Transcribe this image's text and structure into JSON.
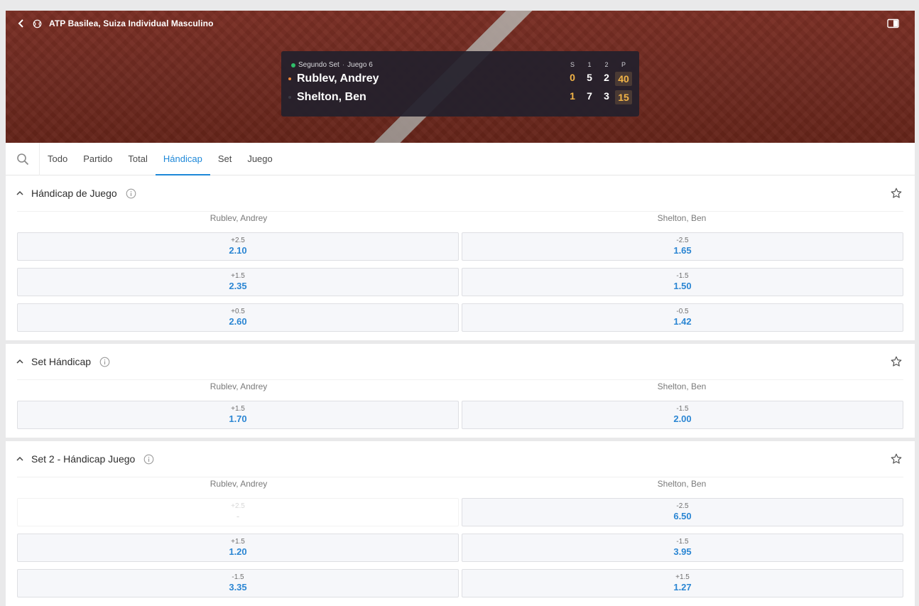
{
  "header": {
    "title": "ATP Basilea, Suiza Individual Masculino",
    "back_icon": "chevron-left-icon",
    "sport_icon": "tennis-ball-icon",
    "panel_icon": "panel-toggle-icon"
  },
  "scoreboard": {
    "status": "Segundo Set",
    "game": "Juego 6",
    "headers": [
      "S",
      "1",
      "2",
      "P"
    ],
    "players": [
      {
        "name": "Rublev, Andrey",
        "sets": "0",
        "set1": "5",
        "set2": "2",
        "points": "40",
        "serving": true
      },
      {
        "name": "Shelton, Ben",
        "sets": "1",
        "set1": "7",
        "set2": "3",
        "points": "15",
        "serving": false
      }
    ],
    "colors": {
      "accent": "#f2b447",
      "live": "#2fbf6a",
      "serve": "#f28a3a"
    }
  },
  "tabs": [
    "Todo",
    "Partido",
    "Total",
    "Hándicap",
    "Set",
    "Juego"
  ],
  "active_tab": "Hándicap",
  "sections": [
    {
      "title": "Hándicap de Juego",
      "home": "Rublev, Andrey",
      "away": "Shelton, Ben",
      "rows": [
        {
          "home_line": "+2.5",
          "home_price": "2.10",
          "away_line": "-2.5",
          "away_price": "1.65"
        },
        {
          "home_line": "+1.5",
          "home_price": "2.35",
          "away_line": "-1.5",
          "away_price": "1.50"
        },
        {
          "home_line": "+0.5",
          "home_price": "2.60",
          "away_line": "-0.5",
          "away_price": "1.42"
        }
      ]
    },
    {
      "title": "Set Hándicap",
      "home": "Rublev, Andrey",
      "away": "Shelton, Ben",
      "rows": [
        {
          "home_line": "+1.5",
          "home_price": "1.70",
          "away_line": "-1.5",
          "away_price": "2.00"
        }
      ]
    },
    {
      "title": "Set 2 - Hándicap Juego",
      "home": "Rublev, Andrey",
      "away": "Shelton, Ben",
      "rows": [
        {
          "home_line": "+2.5",
          "home_price": "-",
          "away_line": "-2.5",
          "away_price": "6.50",
          "home_disabled": true
        },
        {
          "home_line": "+1.5",
          "home_price": "1.20",
          "away_line": "-1.5",
          "away_price": "3.95"
        },
        {
          "home_line": "-1.5",
          "home_price": "3.35",
          "away_line": "+1.5",
          "away_price": "1.27"
        }
      ]
    }
  ]
}
